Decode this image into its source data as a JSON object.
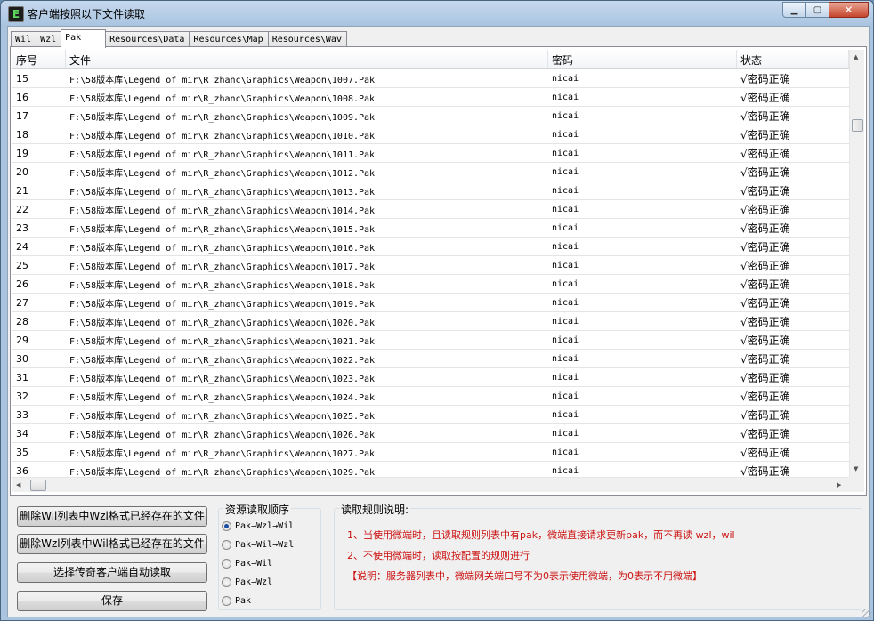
{
  "window": {
    "title": "客户端按照以下文件读取",
    "icon_letter": "E",
    "minimize_glyph": "▁",
    "maximize_glyph": "▢",
    "close_glyph": "✕"
  },
  "tabs": [
    {
      "label": "Wil",
      "active": false
    },
    {
      "label": "Wzl",
      "active": false
    },
    {
      "label": "Pak",
      "active": true
    },
    {
      "label": "Resources\\Data",
      "active": false
    },
    {
      "label": "Resources\\Map",
      "active": false
    },
    {
      "label": "Resources\\Wav",
      "active": false
    }
  ],
  "table": {
    "columns": [
      "序号",
      "文件",
      "密码",
      "状态"
    ],
    "rows": [
      [
        "15",
        "F:\\58版本库\\Legend of mir\\R_zhanc\\Graphics\\Weapon\\1007.Pak",
        "nicai",
        "√密码正确"
      ],
      [
        "16",
        "F:\\58版本库\\Legend of mir\\R_zhanc\\Graphics\\Weapon\\1008.Pak",
        "nicai",
        "√密码正确"
      ],
      [
        "17",
        "F:\\58版本库\\Legend of mir\\R_zhanc\\Graphics\\Weapon\\1009.Pak",
        "nicai",
        "√密码正确"
      ],
      [
        "18",
        "F:\\58版本库\\Legend of mir\\R_zhanc\\Graphics\\Weapon\\1010.Pak",
        "nicai",
        "√密码正确"
      ],
      [
        "19",
        "F:\\58版本库\\Legend of mir\\R_zhanc\\Graphics\\Weapon\\1011.Pak",
        "nicai",
        "√密码正确"
      ],
      [
        "20",
        "F:\\58版本库\\Legend of mir\\R_zhanc\\Graphics\\Weapon\\1012.Pak",
        "nicai",
        "√密码正确"
      ],
      [
        "21",
        "F:\\58版本库\\Legend of mir\\R_zhanc\\Graphics\\Weapon\\1013.Pak",
        "nicai",
        "√密码正确"
      ],
      [
        "22",
        "F:\\58版本库\\Legend of mir\\R_zhanc\\Graphics\\Weapon\\1014.Pak",
        "nicai",
        "√密码正确"
      ],
      [
        "23",
        "F:\\58版本库\\Legend of mir\\R_zhanc\\Graphics\\Weapon\\1015.Pak",
        "nicai",
        "√密码正确"
      ],
      [
        "24",
        "F:\\58版本库\\Legend of mir\\R_zhanc\\Graphics\\Weapon\\1016.Pak",
        "nicai",
        "√密码正确"
      ],
      [
        "25",
        "F:\\58版本库\\Legend of mir\\R_zhanc\\Graphics\\Weapon\\1017.Pak",
        "nicai",
        "√密码正确"
      ],
      [
        "26",
        "F:\\58版本库\\Legend of mir\\R_zhanc\\Graphics\\Weapon\\1018.Pak",
        "nicai",
        "√密码正确"
      ],
      [
        "27",
        "F:\\58版本库\\Legend of mir\\R_zhanc\\Graphics\\Weapon\\1019.Pak",
        "nicai",
        "√密码正确"
      ],
      [
        "28",
        "F:\\58版本库\\Legend of mir\\R_zhanc\\Graphics\\Weapon\\1020.Pak",
        "nicai",
        "√密码正确"
      ],
      [
        "29",
        "F:\\58版本库\\Legend of mir\\R_zhanc\\Graphics\\Weapon\\1021.Pak",
        "nicai",
        "√密码正确"
      ],
      [
        "30",
        "F:\\58版本库\\Legend of mir\\R_zhanc\\Graphics\\Weapon\\1022.Pak",
        "nicai",
        "√密码正确"
      ],
      [
        "31",
        "F:\\58版本库\\Legend of mir\\R_zhanc\\Graphics\\Weapon\\1023.Pak",
        "nicai",
        "√密码正确"
      ],
      [
        "32",
        "F:\\58版本库\\Legend of mir\\R_zhanc\\Graphics\\Weapon\\1024.Pak",
        "nicai",
        "√密码正确"
      ],
      [
        "33",
        "F:\\58版本库\\Legend of mir\\R_zhanc\\Graphics\\Weapon\\1025.Pak",
        "nicai",
        "√密码正确"
      ],
      [
        "34",
        "F:\\58版本库\\Legend of mir\\R_zhanc\\Graphics\\Weapon\\1026.Pak",
        "nicai",
        "√密码正确"
      ],
      [
        "35",
        "F:\\58版本库\\Legend of mir\\R_zhanc\\Graphics\\Weapon\\1027.Pak",
        "nicai",
        "√密码正确"
      ],
      [
        "36",
        "F:\\58版本库\\Legend of mir\\R_zhanc\\Graphics\\Weapon\\1029.Pak",
        "nicai",
        "√密码正确"
      ]
    ]
  },
  "scrollbar_arrows": {
    "up": "▲",
    "down": "▼",
    "left": "◀",
    "right": "▶"
  },
  "buttons": {
    "delete_wil": "删除Wil列表中Wzl格式已经存在的文件",
    "delete_wzl": "删除Wzl列表中Wil格式已经存在的文件",
    "select_client": "选择传奇客户端自动读取",
    "save": "保存"
  },
  "order_group": {
    "title": "资源读取顺序",
    "options": [
      {
        "label": "Pak→Wzl→Wil",
        "checked": true
      },
      {
        "label": "Pak→Wil→Wzl",
        "checked": false
      },
      {
        "label": "Pak→Wil",
        "checked": false
      },
      {
        "label": "Pak→Wzl",
        "checked": false
      },
      {
        "label": "Pak",
        "checked": false
      }
    ]
  },
  "rules": {
    "title": "读取规则说明:",
    "line1": "1、当使用微端时，且读取规则列表中有pak，微端直接请求更新pak，而不再读 wzl，wil",
    "line2": "2、不使用微端时，读取按配置的规则进行",
    "line3": "【说明：服务器列表中，微端网关端口号不为0表示使用微端，为0表示不用微端】"
  },
  "colors": {
    "rule_text": "#cc1111",
    "title_gradient_top": "#c5d9ee",
    "close_button": "#c6452c"
  }
}
